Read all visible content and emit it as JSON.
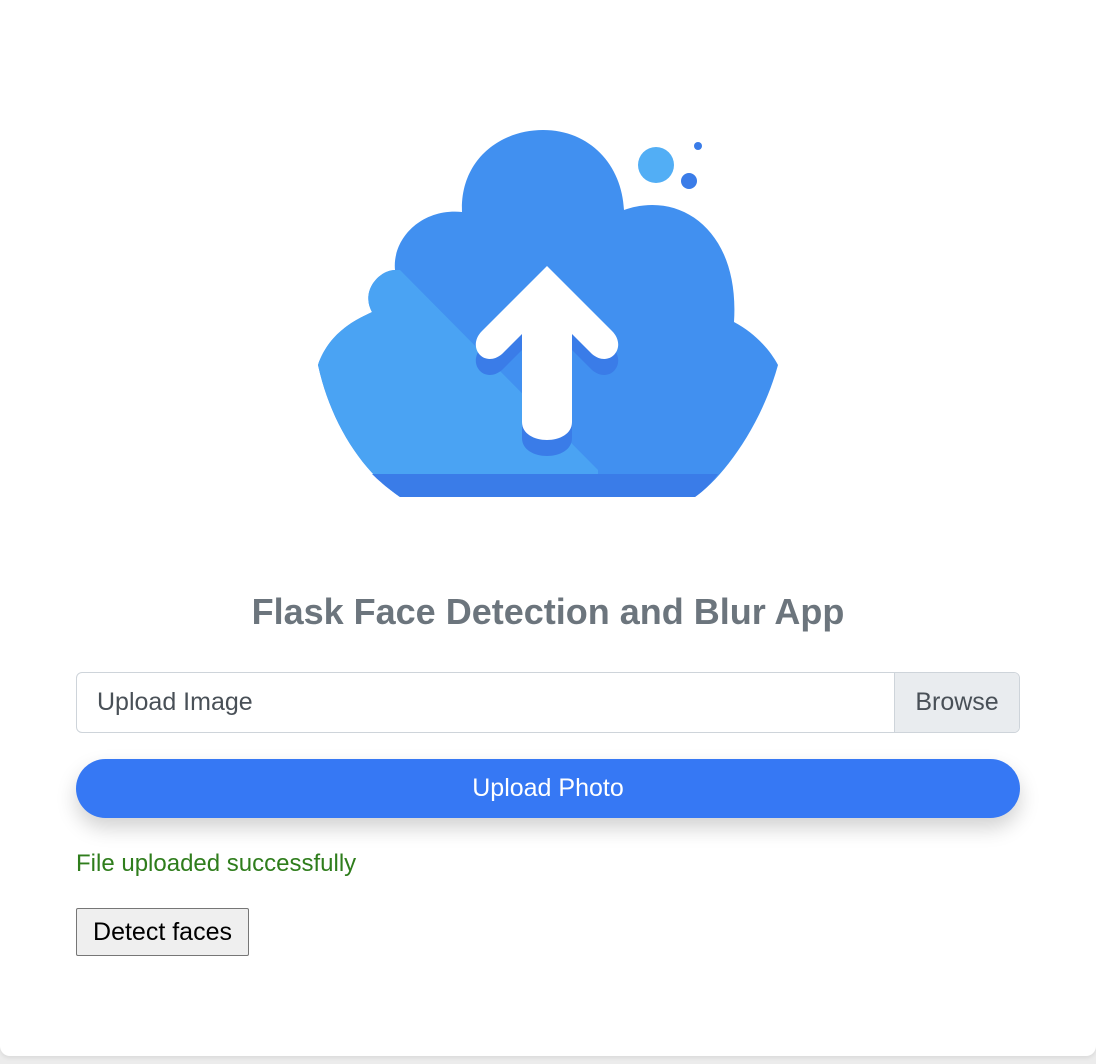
{
  "hero": {
    "icon": "cloud-upload-icon",
    "colors": {
      "cloud_main": "#4190f0",
      "cloud_light": "#4aa3f3",
      "cloud_base": "#3a7ce8",
      "arrow": "#ffffff",
      "bubble_light": "#52aef5",
      "bubble_dark": "#3a7ce8"
    }
  },
  "title": "Flask Face Detection and Blur App",
  "upload_form": {
    "file_label": "Upload Image",
    "browse_label": "Browse",
    "submit_label": "Upload Photo",
    "accent_color": "#3678f4"
  },
  "status": {
    "message": "File uploaded successfully",
    "color": "#2f7d1c"
  },
  "actions": {
    "detect_label": "Detect faces"
  }
}
